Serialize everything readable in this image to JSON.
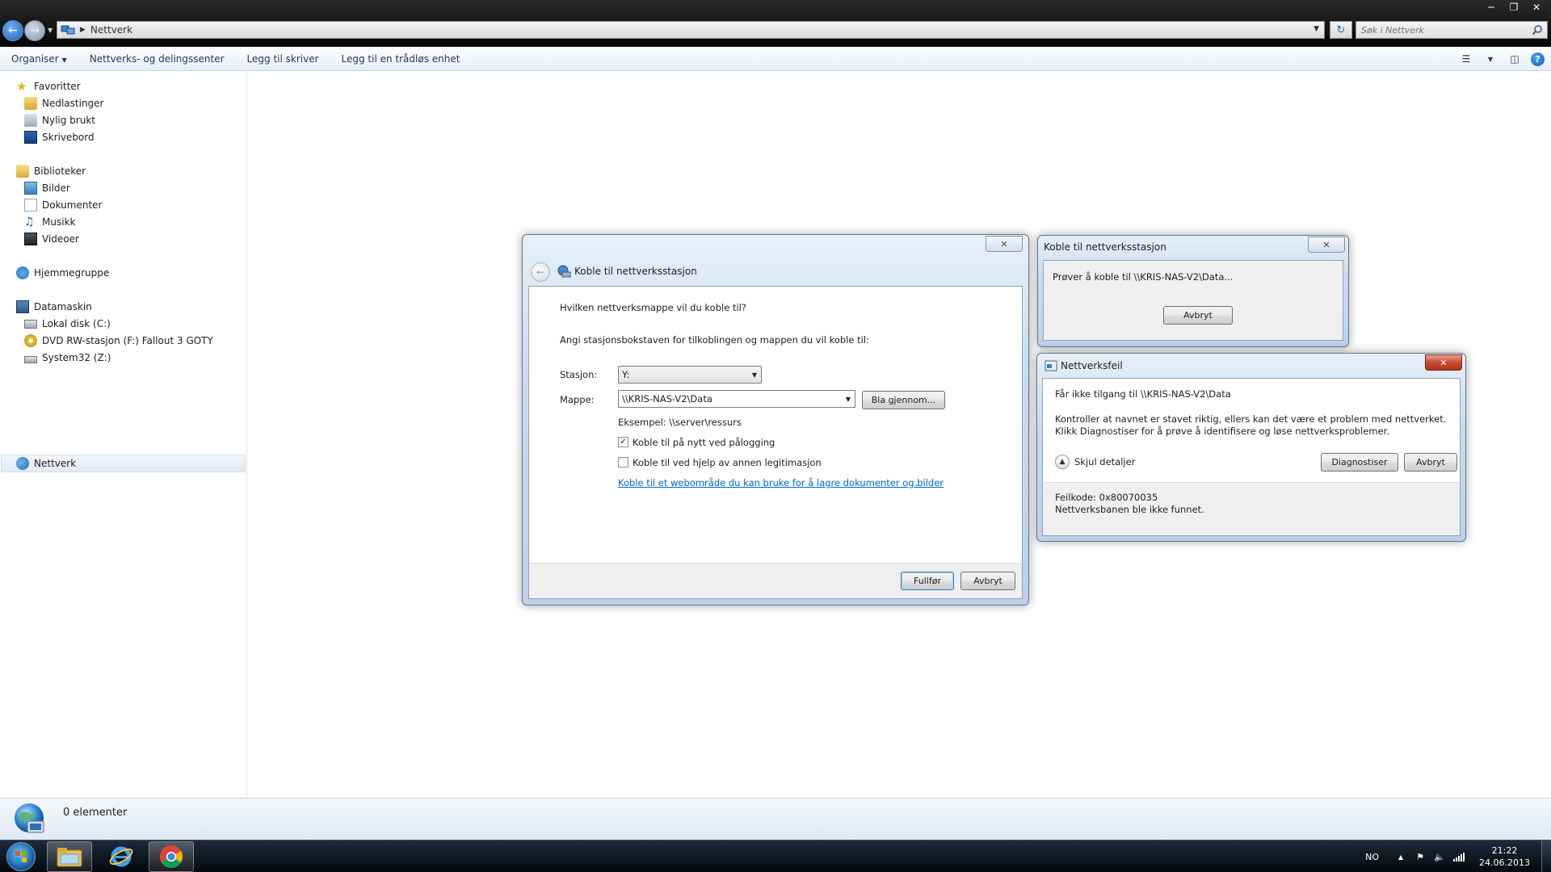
{
  "explorer": {
    "address": "Nettverk",
    "search_placeholder": "Søk i Nettverk",
    "commands": [
      "Organiser",
      "Nettverks- og delingssenter",
      "Legg til skriver",
      "Legg til en trådløs enhet"
    ],
    "nav": {
      "favorites": {
        "label": "Favoritter",
        "items": [
          "Nedlastinger",
          "Nylig brukt",
          "Skrivebord"
        ]
      },
      "libraries": {
        "label": "Biblioteker",
        "items": [
          "Bilder",
          "Dokumenter",
          "Musikk",
          "Videoer"
        ]
      },
      "homegroup": "Hjemmegruppe",
      "computer": {
        "label": "Datamaskin",
        "items": [
          "Lokal disk (C:)",
          "DVD RW-stasjon (F:) Fallout 3 GOTY",
          "System32 (Z:)"
        ]
      },
      "network": "Nettverk"
    },
    "status": "0 elementer"
  },
  "wizard": {
    "title": "Koble til nettverksstasjon",
    "heading": "Hvilken nettverksmappe vil du koble til?",
    "instruction": "Angi stasjonsbokstaven for tilkoblingen og mappen du vil koble til:",
    "drive_label": "Stasjon:",
    "drive_value": "Y:",
    "folder_label": "Mappe:",
    "folder_value": "\\\\KRIS-NAS-V2\\Data",
    "browse_label": "Bla gjennom...",
    "example": "Eksempel: \\\\server\\ressurs",
    "reconnect_label": "Koble til på nytt ved pålogging",
    "reconnect_checked": true,
    "other_credentials_label": "Koble til ved hjelp av annen legitimasjon",
    "other_credentials_checked": false,
    "website_link": "Koble til et webområde du kan bruke for å lagre dokumenter og bilder",
    "website_link_suffix": ".",
    "finish_label": "Fullfør",
    "cancel_label": "Avbryt"
  },
  "progress_dialog": {
    "title": "Koble til nettverksstasjon",
    "message": "Prøver å koble til \\\\KRIS-NAS-V2\\Data...",
    "cancel_label": "Avbryt"
  },
  "error_dialog": {
    "title": "Nettverksfeil",
    "heading": "Får ikke tilgang til \\\\KRIS-NAS-V2\\Data",
    "message": "Kontroller at navnet er stavet riktig, ellers kan det være et problem med nettverket. Klikk Diagnostiser for å prøve å identifisere og løse nettverksproblemer.",
    "hide_details_label": "Skjul detaljer",
    "diagnose_label": "Diagnostiser",
    "cancel_label": "Avbryt",
    "error_code": "Feilkode: 0x80070035",
    "error_text": "Nettverksbanen ble ikke funnet."
  },
  "taskbar": {
    "language": "NO",
    "time": "21:22",
    "date": "24.06.2013"
  },
  "colors": {
    "heading_blue": "#1e3287",
    "link_blue": "#0066cc",
    "command_text": "#1e395b"
  }
}
